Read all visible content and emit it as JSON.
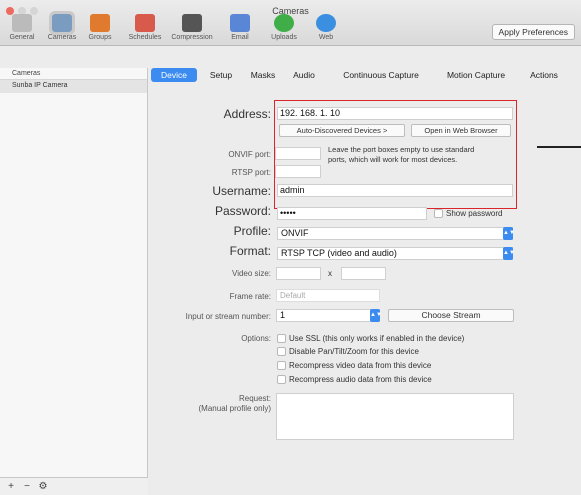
{
  "window": {
    "title": "Cameras"
  },
  "toolbar": {
    "items": [
      {
        "label": "General",
        "color": "#bbbbbb"
      },
      {
        "label": "Cameras",
        "color": "#7a9cc0"
      },
      {
        "label": "Groups",
        "color": "#e07a2e"
      },
      {
        "label": "Schedules",
        "color": "#d75a4a"
      },
      {
        "label": "Compression",
        "color": "#555555"
      },
      {
        "label": "Email",
        "color": "#5a86d6"
      },
      {
        "label": "Uploads",
        "color": "#3fae49"
      },
      {
        "label": "Web",
        "color": "#3a8fe0"
      }
    ],
    "apply_label": "Apply Preferences"
  },
  "sidebar": {
    "header": "Cameras",
    "items": [
      {
        "label": "Sunba IP Camera"
      }
    ],
    "footer": {
      "add": "+",
      "remove": "−",
      "settings": "⚙"
    }
  },
  "tabs": [
    "Device",
    "Setup",
    "Masks",
    "Audio",
    "Continuous Capture",
    "Motion Capture",
    "Actions"
  ],
  "device": {
    "address_label": "Address:",
    "address_value": "192. 168. 1. 10",
    "auto_discovered_label": "Auto-Discovered Devices >",
    "open_browser_label": "Open in Web Browser",
    "onvif_port_label": "ONVIF port:",
    "onvif_port_value": "",
    "rtsp_port_label": "RTSP port:",
    "rtsp_port_value": "",
    "port_note": "Leave the port boxes empty to use standard ports, which will work for most devices.",
    "username_label": "Username:",
    "username_value": "admin",
    "password_label": "Password:",
    "password_value": "•••••",
    "show_password_label": "Show password",
    "profile_label": "Profile:",
    "profile_value": "ONVIF",
    "format_label": "Format:",
    "format_value": "RTSP TCP (video and audio)",
    "video_size_label": "Video size:",
    "video_size_x": "x",
    "frame_rate_label": "Frame rate:",
    "frame_rate_value": "Default",
    "stream_label": "Input or stream number:",
    "stream_value": "1",
    "choose_stream_label": "Choose Stream",
    "options_label": "Options:",
    "options": [
      "Use SSL (this only works if enabled in the device)",
      "Disable Pan/Tilt/Zoom for this device",
      "Recompress video data from this device",
      "Recompress audio data from this device"
    ],
    "request_label": "Request:",
    "request_sub_label": "(Manual profile only)"
  },
  "colors": {
    "accent": "#3b8bf0",
    "highlight": "#d9262b"
  }
}
